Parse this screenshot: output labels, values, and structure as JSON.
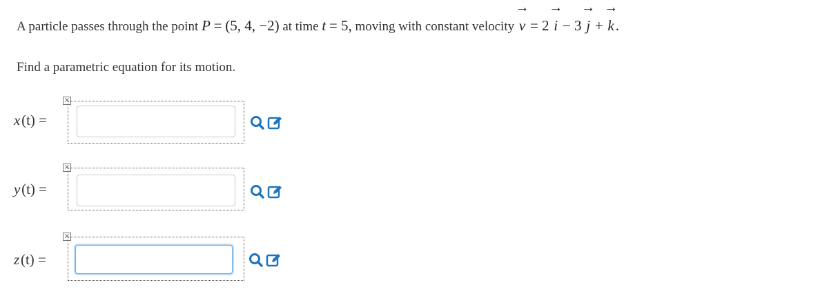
{
  "question": {
    "intro": "A particle passes through the point",
    "point_label": "P",
    "equals": "=",
    "point_value": "(5, 4, −2)",
    "at_time": "at time",
    "t_var": "t",
    "t_value": "= 5,",
    "moving": "moving with constant velocity",
    "v_symbol": "v",
    "eq2": "= 2",
    "i_symbol": "i",
    "minus3": "− 3",
    "j_symbol": "j",
    "plus": "+",
    "k_symbol": "k",
    "period": "."
  },
  "instruction": "Find a parametric equation for its motion.",
  "rows": [
    {
      "fn": "x",
      "arg": "(t)",
      "eq": "=",
      "value": "",
      "focused": false
    },
    {
      "fn": "y",
      "arg": "(t)",
      "eq": "=",
      "value": "",
      "focused": false
    },
    {
      "fn": "z",
      "arg": "(t)",
      "eq": "=",
      "value": "",
      "focused": true
    }
  ],
  "icons": {
    "preview": "magnifier-icon",
    "editor": "edit-pencil-icon",
    "broken": "broken-image-icon"
  },
  "colors": {
    "accent": "#1e73be",
    "focus": "#66afe9"
  }
}
